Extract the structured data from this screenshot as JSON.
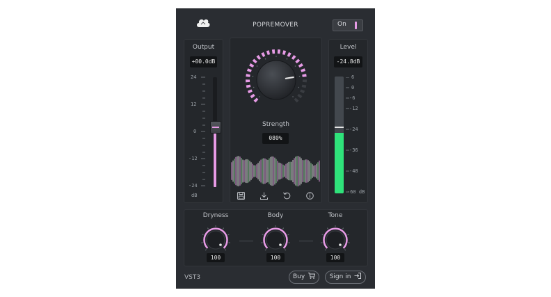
{
  "header": {
    "title": "POPREMOVER",
    "power_label": "On",
    "logo_icon": "cloud-logo-icon"
  },
  "output": {
    "label": "Output",
    "value": "+00.0dB",
    "ticks": [
      "24",
      "12",
      "0",
      "-12",
      "-24"
    ],
    "unit": "dB",
    "level_fraction": 0.55
  },
  "level": {
    "label": "Level",
    "value": "-24.8dB",
    "ticks": [
      "6",
      "0",
      "-6",
      "-12",
      "-24",
      "-36",
      "-48",
      "-60 dB"
    ],
    "meter_fraction": 0.52,
    "peak_fraction": 0.57
  },
  "strength": {
    "label": "Strength",
    "value": "080%",
    "fraction": 0.8
  },
  "toolbar": {
    "icons": [
      "save-icon",
      "download-icon",
      "reset-icon",
      "info-icon"
    ]
  },
  "macros": [
    {
      "label": "Dryness",
      "value": "100"
    },
    {
      "label": "Body",
      "value": "100"
    },
    {
      "label": "Tone",
      "value": "100"
    }
  ],
  "footer": {
    "format": "VST3",
    "buy_label": "Buy",
    "signin_label": "Sign in"
  },
  "colors": {
    "accent": "#e79be6",
    "meter": "#2fe27a",
    "background": "#2a2d32"
  }
}
